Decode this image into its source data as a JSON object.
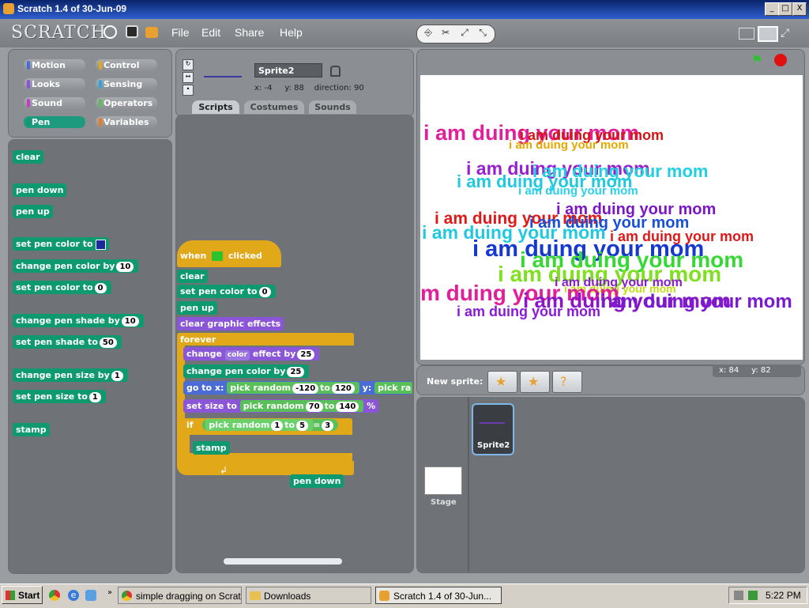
{
  "window": {
    "title": "Scratch 1.4 of 30-Jun-09",
    "btn_min": "_",
    "btn_max": "□",
    "btn_close": "X"
  },
  "menu": {
    "logo": "SCRATCH",
    "file": "File",
    "edit": "Edit",
    "share": "Share",
    "help": "Help"
  },
  "categories": {
    "motion": "Motion",
    "control": "Control",
    "looks": "Looks",
    "sensing": "Sensing",
    "sound": "Sound",
    "operators": "Operators",
    "pen": "Pen",
    "variables": "Variables"
  },
  "palette": {
    "clear": "clear",
    "pen_down": "pen down",
    "pen_up": "pen up",
    "set_pen_color": "set pen color to",
    "change_pen_color": "change pen color by",
    "change_pen_color_val": "10",
    "set_pen_color_num": "set pen color to",
    "set_pen_color_num_val": "0",
    "change_shade": "change pen shade by",
    "change_shade_val": "10",
    "set_shade": "set pen shade to",
    "set_shade_val": "50",
    "change_size": "change pen size by",
    "change_size_val": "1",
    "set_size": "set pen size to",
    "set_size_val": "1",
    "stamp": "stamp"
  },
  "sprite": {
    "name": "Sprite2",
    "x_label": "x:",
    "x": "-4",
    "y_label": "y:",
    "y": "88",
    "dir_label": "direction:",
    "dir": "90"
  },
  "tabs": {
    "scripts": "Scripts",
    "costumes": "Costumes",
    "sounds": "Sounds"
  },
  "script": {
    "when": "when",
    "clicked": "clicked",
    "clear": "clear",
    "set_pen_color": "set pen color to",
    "set_pen_color_val": "0",
    "pen_up": "pen up",
    "clear_effects": "clear graphic effects",
    "forever": "forever",
    "change": "change",
    "effect_dropdown": "color",
    "effect_by": "effect by",
    "effect_val": "25",
    "change_pen_color": "change pen color by",
    "change_pen_color_val": "25",
    "goto": "go to x:",
    "pick_random": "pick random",
    "rand_x_from": "-120",
    "to": "to",
    "rand_x_to": "120",
    "y": "y:",
    "pick_random_cut": "pick ra",
    "set_size": "set size to",
    "rand_size_from": "70",
    "rand_size_to": "140",
    "percent": "%",
    "if": "if",
    "rand_if_from": "1",
    "rand_if_to": "5",
    "equals": "=",
    "equals_val": "3",
    "stamp": "stamp",
    "pen_down_loose": "pen down"
  },
  "stage_text": "i am duing your mom",
  "stage_text_cut": "m duing your mom",
  "stamps": [
    {
      "t": "i am duing your mom",
      "c": "#e0209a"
    },
    {
      "t": "i am duing your mom",
      "c": "#d41414"
    },
    {
      "t": "i am duing your mom",
      "c": "#e6a800"
    },
    {
      "t": "i am duing your mom",
      "c": "#9a1fd0"
    },
    {
      "t": "i am duing your mom",
      "c": "#20d0e0"
    },
    {
      "t": "i am duing your mom",
      "c": "#20c8e0"
    },
    {
      "t": "i am duing your mom",
      "c": "#2ad0ea"
    },
    {
      "t": "i am duing your mom",
      "c": "#7a16c8"
    },
    {
      "t": "i am duing your mom",
      "c": "#e01818"
    },
    {
      "t": "i am duing your mom",
      "c": "#1850d8"
    },
    {
      "t": "i am duing your mom",
      "c": "#20c8e0"
    },
    {
      "t": "i am duing your mom",
      "c": "#e01818"
    },
    {
      "t": "i am duing your mom",
      "c": "#1438d0"
    },
    {
      "t": "i am duing your mom",
      "c": "#36d836"
    },
    {
      "t": "i am duing your mom",
      "c": "#7ee01e"
    },
    {
      "t": "i am duing your mom",
      "c": "#8a1ad8"
    },
    {
      "t": "i am duing your mom",
      "c": "#c0e010"
    },
    {
      "t": "m duing your mom",
      "c": "#e0209a"
    },
    {
      "t": "i am duing your mom",
      "c": "#8a16c8"
    },
    {
      "t": "i am duing your mom",
      "c": "#7a1ad0"
    },
    {
      "t": "i am duing your mom",
      "c": "#8a1ad8"
    }
  ],
  "new_sprite": "New sprite:",
  "mouse": {
    "x_label": "x:",
    "x": "84",
    "y_label": "y:",
    "y": "82"
  },
  "sprites_list": {
    "stage": "Stage",
    "sprite2": "Sprite2"
  },
  "taskbar": {
    "start": "Start",
    "task1": "simple dragging on Scrat...",
    "task2": "Downloads",
    "task3": "Scratch 1.4 of 30-Jun...",
    "clock": "5:22 PM"
  },
  "colors": {
    "pen_block": "#0e9a6e",
    "control_block": "#e1a91a",
    "looks_block": "#8a55d7",
    "motion_block": "#4a6cd4",
    "operator_block": "#59c059",
    "green_flag": "#2ec22e",
    "stop": "#e01010"
  }
}
